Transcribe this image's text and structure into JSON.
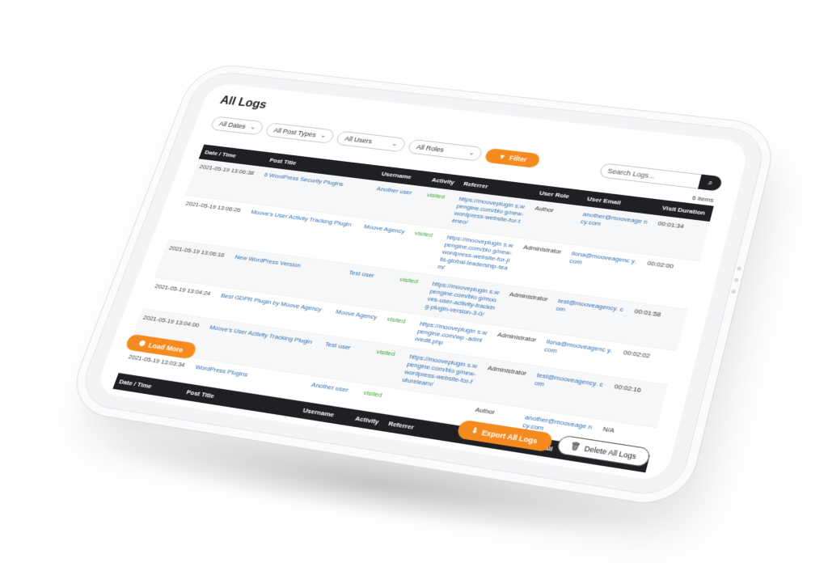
{
  "page": {
    "title": "All Logs"
  },
  "filters": {
    "dates": "All Dates",
    "post_types": "All Post Types",
    "users": "All Users",
    "roles": "All Roles",
    "filter_button": "Filter"
  },
  "search": {
    "placeholder": "Search Logs..."
  },
  "count_label": "6 items",
  "columns": [
    "Date / Time",
    "Post Title",
    "Username",
    "Activity",
    "Referrer",
    "User Role",
    "User Email",
    "Visit Duration"
  ],
  "rows": [
    {
      "date": "2021-05-19 13:06:38",
      "post_title": "6 WordPress Security Plugins",
      "username": "Another user",
      "activity": "visited",
      "referrer": "https://mooveplugin s.wpengine.com/blo g/new-wordpress-website-for-teneo/",
      "role": "Author",
      "email": "another@mooveage ncy.com",
      "duration": "00:01:34"
    },
    {
      "date": "2021-05-19 13:06:26",
      "post_title": "Moove's User Activity Tracking Plugin",
      "username": "Moove Agency",
      "activity": "visited",
      "referrer": "https://mooveplugin s.wpengine.com/blo g/new-wordpress-website-for-jills-global-leadership-team/",
      "role": "Administrator",
      "email": "ilona@mooveagenc y.com",
      "duration": "00:02:00"
    },
    {
      "date": "2021-05-19 13:06:16",
      "post_title": "New WordPress Version",
      "username": "Test user",
      "activity": "visited",
      "referrer": "https://mooveplugin s.wpengine.com/blo g/mooves-user-activity-tracking-plugin-version-3-0/",
      "role": "Administrator",
      "email": "test@mooveagency. com",
      "duration": "00:01:58"
    },
    {
      "date": "2021-05-19 13:04:24",
      "post_title": "Best GDPR Plugin by Moove Agency",
      "username": "Moove Agency",
      "activity": "visited",
      "referrer": "https://mooveplugin s.wpengine.com/wp -admin/edit.php",
      "role": "Administrator",
      "email": "ilona@mooveagenc y.com",
      "duration": "00:02:02"
    },
    {
      "date": "2021-05-19 13:04:00",
      "post_title": "Moove's User Activity Tracking Plugin",
      "username": "Test user",
      "activity": "visited",
      "referrer": "https://mooveplugin s.wpengine.com/blo g/new-wordpress-website-for-futurelearn/",
      "role": "Administrator",
      "email": "test@mooveagency. com",
      "duration": "00:02:16"
    },
    {
      "date": "2021-05-19 13:03:34",
      "post_title": "WordPress Plugins",
      "username": "Another user",
      "activity": "visited",
      "referrer": "",
      "role": "Author",
      "email": "another@mooveage ncy.com",
      "duration": "N/A"
    }
  ],
  "buttons": {
    "load_more": "Load More",
    "export": "Export All Logs",
    "delete": "Delete All Logs"
  },
  "colors": {
    "accent": "#f58b1f",
    "dark": "#1f2024",
    "link": "#2f6fb0",
    "visited": "#3aa53a"
  }
}
